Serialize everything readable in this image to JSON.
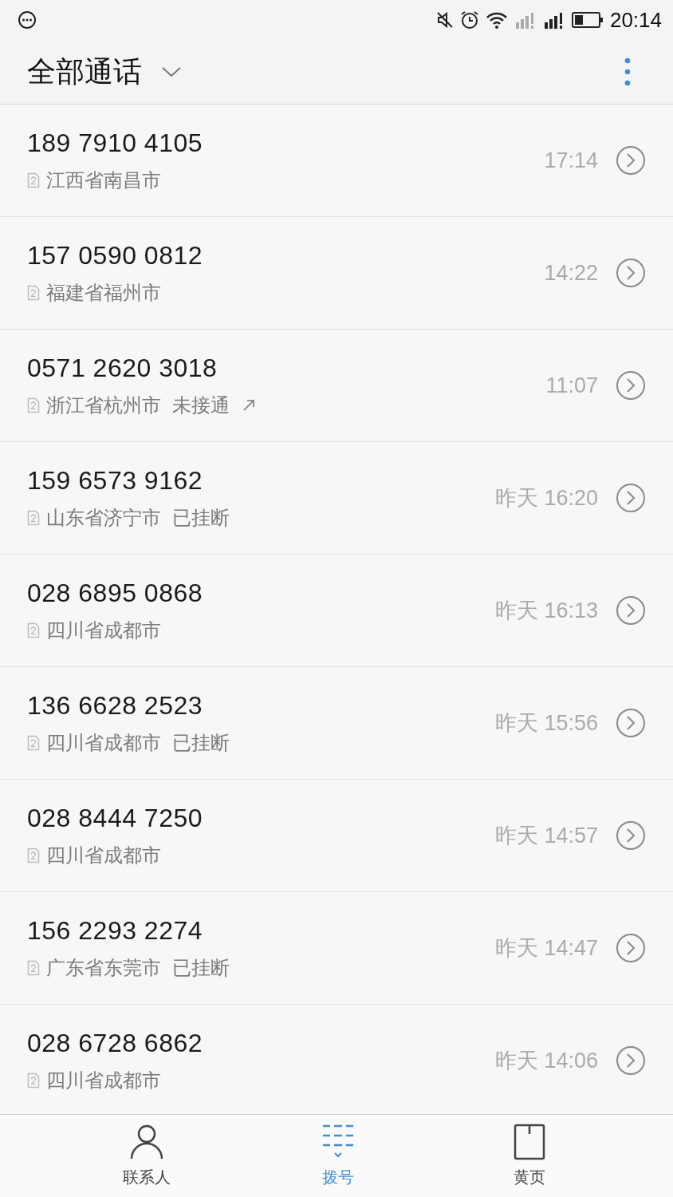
{
  "status_bar": {
    "time": "20:14"
  },
  "header": {
    "title": "全部通话"
  },
  "calls": [
    {
      "number": "189 7910 4105",
      "location": "江西省南昌市",
      "time": "17:14",
      "outgoing": false
    },
    {
      "number": "157 0590 0812",
      "location": "福建省福州市",
      "time": "14:22",
      "outgoing": false
    },
    {
      "number": "0571 2620 3018",
      "location": "浙江省杭州市",
      "status": "未接通",
      "time": "11:07",
      "outgoing": true
    },
    {
      "number": "159 6573 9162",
      "location": "山东省济宁市",
      "status": "已挂断",
      "time": "昨天 16:20",
      "outgoing": false
    },
    {
      "number": "028 6895 0868",
      "location": "四川省成都市",
      "time": "昨天 16:13",
      "outgoing": false
    },
    {
      "number": "136 6628 2523",
      "location": "四川省成都市",
      "status": "已挂断",
      "time": "昨天 15:56",
      "outgoing": false
    },
    {
      "number": "028 8444 7250",
      "location": "四川省成都市",
      "time": "昨天 14:57",
      "outgoing": false
    },
    {
      "number": "156 2293 2274",
      "location": "广东省东莞市",
      "status": "已挂断",
      "time": "昨天 14:47",
      "outgoing": false
    },
    {
      "number": "028 6728 6862",
      "location": "四川省成都市",
      "time": "昨天 14:06",
      "outgoing": false
    }
  ],
  "nav": [
    {
      "kind": "contacts",
      "label": "联系人",
      "selected": false
    },
    {
      "kind": "dialer",
      "label": "拨号",
      "selected": true
    },
    {
      "kind": "pages",
      "label": "黄页",
      "selected": false
    }
  ]
}
